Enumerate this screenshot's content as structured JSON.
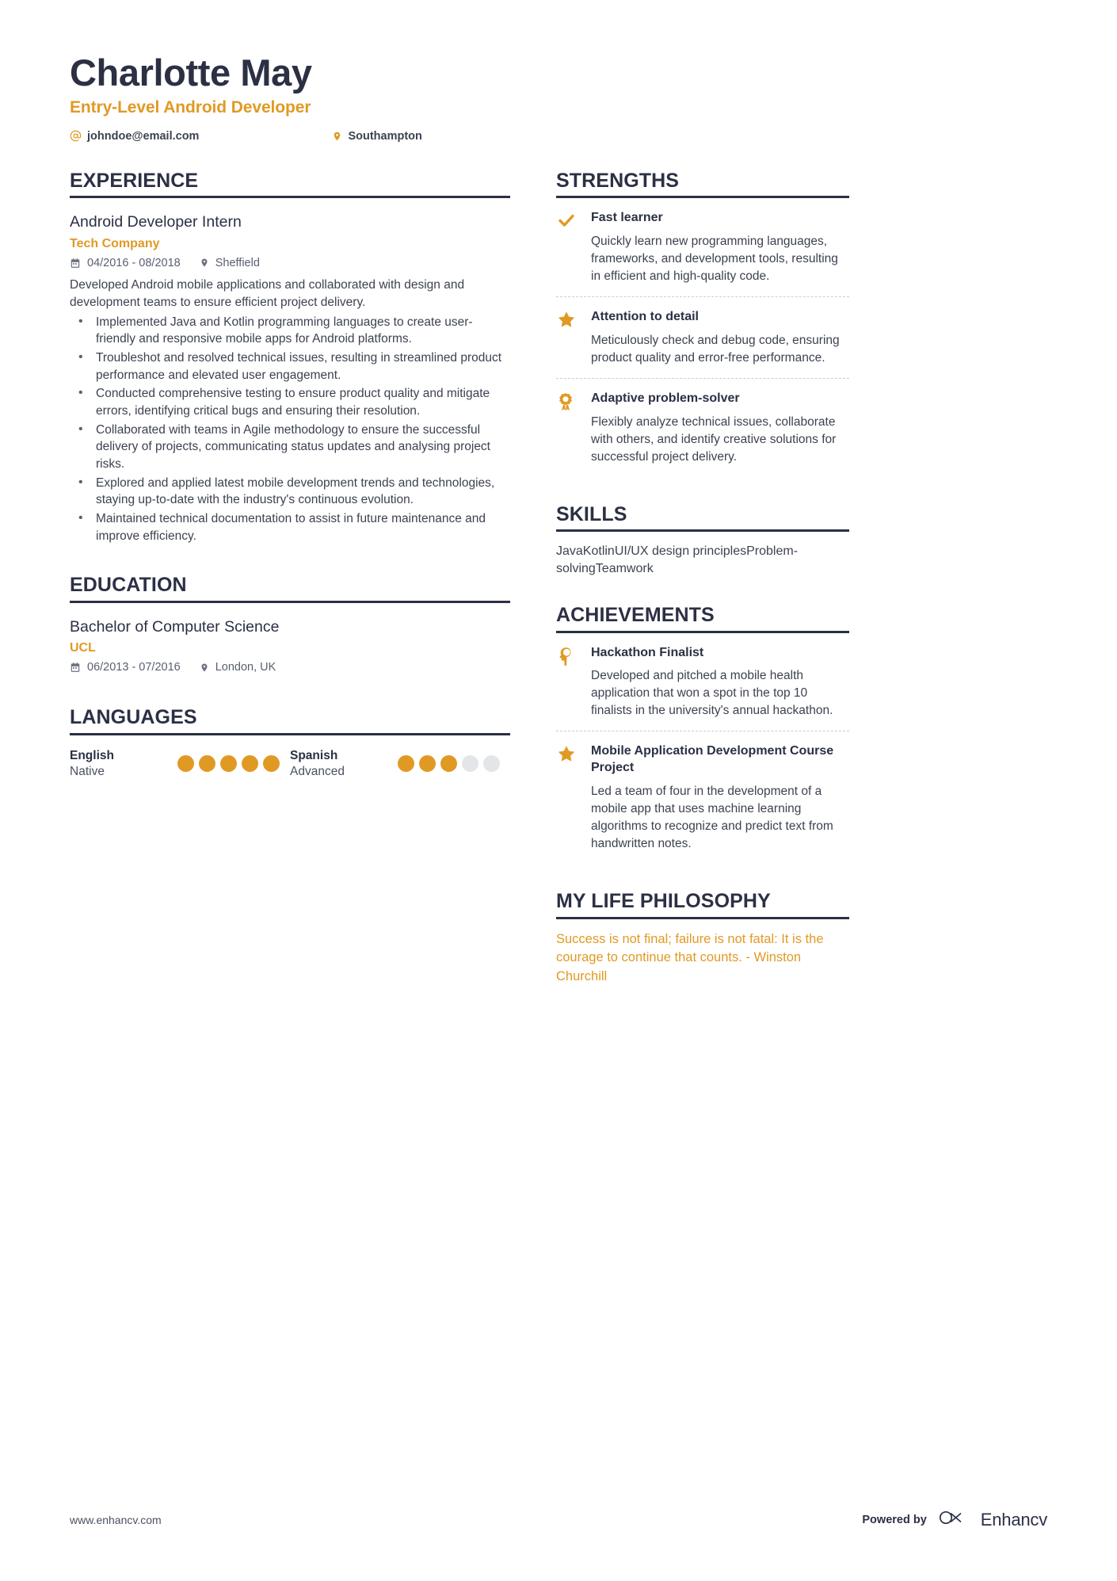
{
  "header": {
    "name": "Charlotte May",
    "role": "Entry-Level Android Developer",
    "contacts": [
      {
        "icon": "at-icon",
        "text": "johndoe@email.com"
      },
      {
        "icon": "location-pin-icon",
        "text": "Southampton"
      }
    ]
  },
  "experience": {
    "title": "EXPERIENCE",
    "entries": [
      {
        "position": "Android Developer Intern",
        "company": "Tech Company",
        "dates": "04/2016 - 08/2018",
        "location": "Sheffield",
        "description": "Developed Android mobile applications and collaborated with design and development teams to ensure efficient project delivery.",
        "bullets": [
          "Implemented Java and Kotlin programming languages to create user-friendly and responsive mobile apps for Android platforms.",
          "Troubleshot and resolved technical issues, resulting in streamlined product performance and elevated user engagement.",
          "Conducted comprehensive testing to ensure product quality and mitigate errors, identifying critical bugs and ensuring their resolution.",
          "Collaborated with teams in Agile methodology to ensure the successful delivery of projects, communicating status updates and analysing project risks.",
          "Explored and applied latest mobile development trends and technologies, staying up-to-date with the industry's continuous evolution.",
          "Maintained technical documentation to assist in future maintenance and improve efficiency."
        ]
      }
    ]
  },
  "education": {
    "title": "EDUCATION",
    "entries": [
      {
        "degree": "Bachelor of Computer Science",
        "school": "UCL",
        "dates": "06/2013 - 07/2016",
        "location": "London, UK"
      }
    ]
  },
  "languages": {
    "title": "LANGUAGES",
    "items": [
      {
        "name": "English",
        "level": "Native",
        "filled": 5,
        "total": 5
      },
      {
        "name": "Spanish",
        "level": "Advanced",
        "filled": 3,
        "total": 5
      }
    ]
  },
  "strengths": {
    "title": "STRENGTHS",
    "items": [
      {
        "icon": "check-icon",
        "title": "Fast learner",
        "text": "Quickly learn new programming languages, frameworks, and development tools, resulting in efficient and high-quality code."
      },
      {
        "icon": "star-icon",
        "title": "Attention to detail",
        "text": "Meticulously check and debug code, ensuring product quality and error-free performance."
      },
      {
        "icon": "award-ribbon-icon",
        "title": "Adaptive problem-solver",
        "text": "Flexibly analyze technical issues, collaborate with others, and identify creative solutions for successful project delivery."
      }
    ]
  },
  "skills": {
    "title": "SKILLS",
    "text": "JavaKotlinUI/UX design principlesProblem-solvingTeamwork"
  },
  "achievements": {
    "title": "ACHIEVEMENTS",
    "items": [
      {
        "icon": "lightbulb-head-icon",
        "title": "Hackathon Finalist",
        "text": "Developed and pitched a mobile health application that won a spot in the top 10 finalists in the university's annual hackathon."
      },
      {
        "icon": "star-icon",
        "title": "Mobile Application Development Course Project",
        "text": "Led a team of four in the development of a mobile app that uses machine learning algorithms to recognize and predict text from handwritten notes."
      }
    ]
  },
  "philosophy": {
    "title": "MY LIFE PHILOSOPHY",
    "text": "Success is not final; failure is not fatal: It is the courage to continue that counts. - Winston Churchill"
  },
  "footer": {
    "url": "www.enhancv.com",
    "powered_by": "Powered by",
    "brand": "Enhancv"
  },
  "colors": {
    "accent": "#e09a24",
    "dark": "#2b3044",
    "body": "#3c4250",
    "dot_empty": "#e3e5e8"
  }
}
